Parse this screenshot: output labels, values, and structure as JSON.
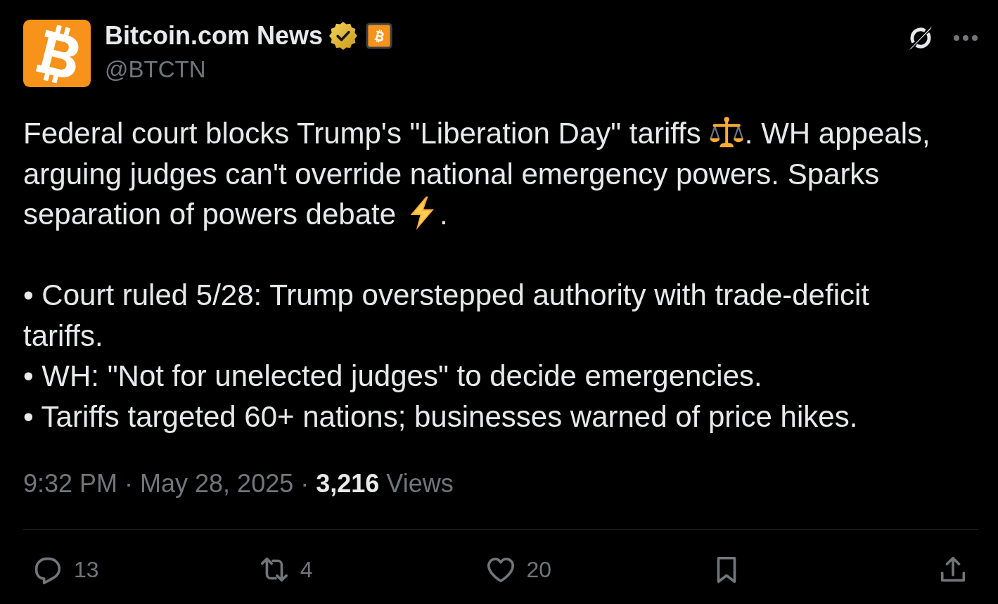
{
  "author": {
    "name": "Bitcoin.com News",
    "handle": "@BTCTN",
    "verified": true
  },
  "body": {
    "lead": [
      {
        "kind": "text",
        "text": "Federal court blocks Trump's \"Liberation Day\" tariffs "
      },
      {
        "kind": "emoji"
      },
      {
        "kind": "text",
        "text": ". WH appeals, arguing judges can't override national emergency powers. Sparks separation of powers debate "
      },
      {
        "kind": "emoji"
      },
      {
        "kind": "text",
        "text": "."
      }
    ],
    "bullets": [
      "• Court ruled 5/28: Trump overstepped authority with trade-deficit tariffs.",
      "• WH: \"Not for unelected judges\" to decide emergencies.",
      "• Tariffs targeted 60+ nations; businesses warned of price hikes."
    ]
  },
  "meta": "9:32 PM · May 28, 2025 · **3,216** Views",
  "actions": [
    {
      "kind": "reply",
      "count": "13"
    },
    {
      "kind": "repost",
      "count": "4"
    },
    {
      "kind": "like",
      "count": "20"
    },
    {
      "kind": "bookmark"
    },
    {
      "kind": "share"
    }
  ]
}
